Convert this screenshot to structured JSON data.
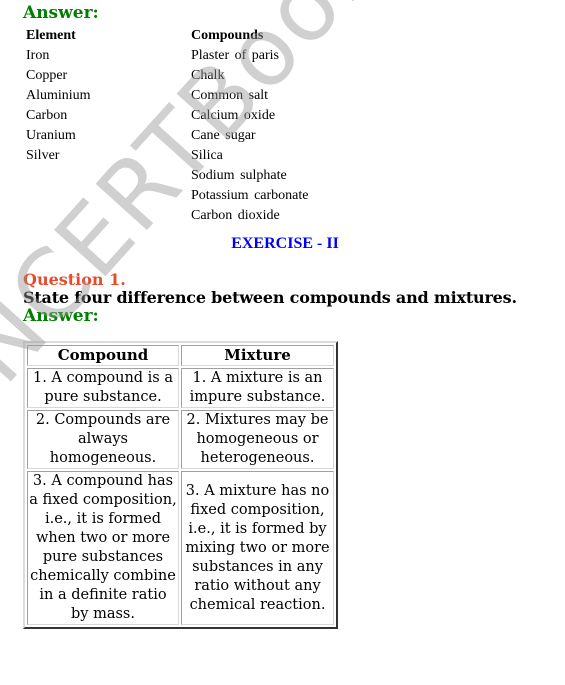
{
  "answer_label": "Answer:",
  "lists": {
    "elements_header": "Element",
    "elements": [
      "Iron",
      "Copper",
      "Aluminium",
      "Carbon",
      "Uranium",
      "Silver"
    ],
    "compounds_header": "Compounds",
    "compounds": [
      "Plaster of paris",
      "Chalk",
      "Common salt",
      "Calcium oxide",
      "Cane sugar",
      "Silica",
      "Sodium sulphate",
      "Potassium carbonate",
      "Carbon dioxide"
    ]
  },
  "exercise_title": "EXERCISE - II",
  "question": {
    "label": "Question 1.",
    "text": "State four difference between compounds and mixtures.",
    "answer_label": "Answer:"
  },
  "table": {
    "headers": [
      "Compound",
      "Mixture"
    ],
    "rows": [
      [
        "1. A compound is a pure substance.",
        "1. A mixture is an impure substance."
      ],
      [
        "2. Compounds are always homogeneous.",
        "2. Mixtures may be homogeneous or heterogeneous."
      ],
      [
        "3. A compound has a fixed composition, i.e., it is formed when two or more pure substances chemically combine in a definite ratio by mass.",
        "3. A mixture has no fixed composition, i.e., it is formed by mixing two or more substances in any ratio without any chemical reaction."
      ]
    ]
  },
  "watermark": "NCERTBooks.Guru",
  "colors": {
    "answer": "#008000",
    "question": "#e84a2c",
    "exercise": "#0000ff"
  }
}
